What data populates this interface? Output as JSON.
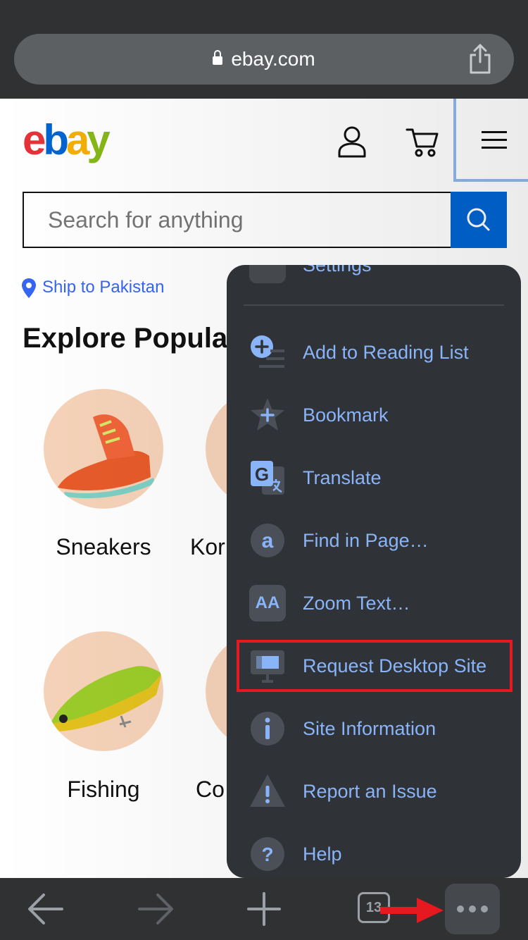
{
  "browser": {
    "url": "ebay.com",
    "tab_count": "13"
  },
  "site": {
    "logo": {
      "e": "e",
      "b": "b",
      "a": "a",
      "y": "y"
    },
    "search_placeholder": "Search for anything",
    "ship_to": "Ship to Pakistan",
    "explore_heading": "Explore Popula",
    "categories": [
      {
        "label": "Sneakers"
      },
      {
        "label": "Kor"
      },
      {
        "label": "Fishing"
      },
      {
        "label": "Co"
      }
    ]
  },
  "menu": {
    "partial_item": "Settings",
    "items": [
      {
        "label": "Add to Reading List",
        "icon": "add-reading-list-icon"
      },
      {
        "label": "Bookmark",
        "icon": "bookmark-star-icon"
      },
      {
        "label": "Translate",
        "icon": "translate-icon"
      },
      {
        "label": "Find in Page…",
        "icon": "find-in-page-icon"
      },
      {
        "label": "Zoom Text…",
        "icon": "zoom-text-icon"
      },
      {
        "label": "Request Desktop Site",
        "icon": "desktop-icon"
      },
      {
        "label": "Site Information",
        "icon": "info-icon"
      },
      {
        "label": "Report an Issue",
        "icon": "warning-icon"
      },
      {
        "label": "Help",
        "icon": "help-icon"
      }
    ],
    "zoom_icon_text": "AA"
  },
  "colors": {
    "ebay_red": "#e53238",
    "ebay_blue": "#0064d2",
    "ebay_yellow": "#f5af02",
    "ebay_green": "#86b817",
    "menu_bg": "#2f3236",
    "menu_text": "#8ab4f8",
    "highlight": "#e5191f"
  }
}
